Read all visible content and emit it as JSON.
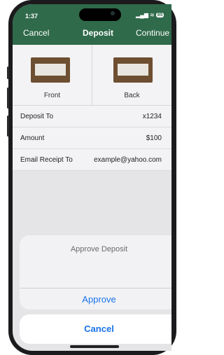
{
  "status": {
    "time": "1:37",
    "signal": "▂▄▆",
    "wifi": "≋",
    "battery": "85"
  },
  "nav": {
    "cancel": "Cancel",
    "title": "Deposit",
    "continue": "Continue"
  },
  "images": [
    {
      "label": "Front"
    },
    {
      "label": "Back"
    }
  ],
  "details": [
    {
      "label": "Deposit To",
      "value": "x1234"
    },
    {
      "label": "Amount",
      "value": "$100"
    },
    {
      "label": "Email Receipt To",
      "value": "example@yahoo.com"
    }
  ],
  "sheet": {
    "title": "Approve Deposit",
    "approve": "Approve",
    "cancel": "Cancel"
  },
  "colors": {
    "header": "#2f6a4a",
    "accent": "#1a73e8"
  }
}
